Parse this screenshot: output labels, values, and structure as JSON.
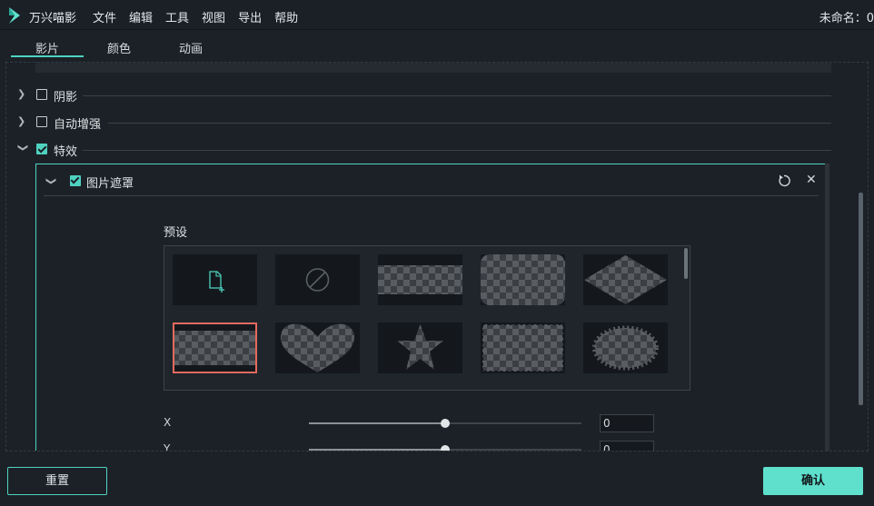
{
  "app": {
    "name": "万兴喵影",
    "document_title": "未命名：0",
    "menu": [
      "文件",
      "编辑",
      "工具",
      "视图",
      "导出",
      "帮助"
    ]
  },
  "tabs": [
    {
      "label": "影片",
      "active": true
    },
    {
      "label": "颜色",
      "active": false
    },
    {
      "label": "动画",
      "active": false
    }
  ],
  "sections": [
    {
      "label": "阴影",
      "expanded": false,
      "checked": false
    },
    {
      "label": "自动增强",
      "expanded": false,
      "checked": false
    },
    {
      "label": "特效",
      "expanded": true,
      "checked": true
    }
  ],
  "effect": {
    "label": "图片遮罩",
    "checked": true,
    "preset_title": "预设",
    "presets": [
      {
        "icon": "add-mask-icon",
        "selected": false
      },
      {
        "icon": "none-icon",
        "selected": false
      },
      {
        "icon": "rectangle-mask",
        "selected": false
      },
      {
        "icon": "rounded-rectangle-mask",
        "selected": false
      },
      {
        "icon": "diamond-mask",
        "selected": false
      },
      {
        "icon": "rectangle-mask",
        "selected": true
      },
      {
        "icon": "heart-mask",
        "selected": false
      },
      {
        "icon": "star-mask",
        "selected": false
      },
      {
        "icon": "stamp-mask",
        "selected": false
      },
      {
        "icon": "burst-ellipse-mask",
        "selected": false
      }
    ],
    "sliders": [
      {
        "axis": "X",
        "value": "0"
      },
      {
        "axis": "Y",
        "value": "0"
      }
    ]
  },
  "buttons": {
    "reset": "重置",
    "confirm": "确认"
  },
  "colors": {
    "accent": "#4fd3c1",
    "selected_outline": "#e56a5e",
    "background": "#1c2127"
  }
}
